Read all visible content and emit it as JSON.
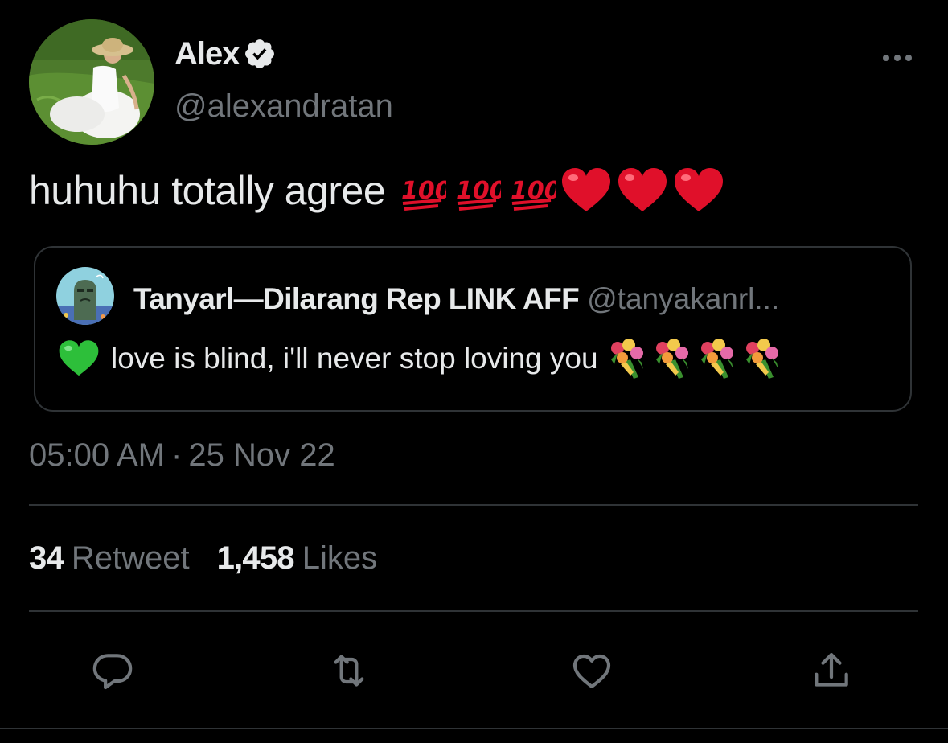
{
  "author": {
    "display_name": "Alex",
    "handle": "@alexandratan",
    "verified_icon": "verified-badge-icon",
    "avatar": "profile-photo-woman-white-dress-on-grass"
  },
  "tweet": {
    "text": "huhuhu totally agree",
    "emojis": [
      "hundred-points",
      "hundred-points",
      "hundred-points",
      "red-heart",
      "red-heart",
      "red-heart"
    ]
  },
  "quote": {
    "display_name": "Tanyarl—Dilarang Rep LINK AFF",
    "handle": "@tanyakanrl...",
    "leading_emoji": "green-heart",
    "text": "love is blind, i'll never stop loving you",
    "trailing_emojis": [
      "bouquet",
      "bouquet",
      "bouquet",
      "bouquet"
    ]
  },
  "meta": {
    "time": "05:00 AM",
    "separator": "·",
    "date": "25 Nov 22"
  },
  "stats": {
    "retweet_count": "34",
    "retweet_label": "Retweet",
    "like_count": "1,458",
    "like_label": "Likes"
  },
  "actions": [
    "reply-icon",
    "retweet-icon",
    "like-icon",
    "share-icon"
  ],
  "colors": {
    "background": "#000000",
    "primary_text": "#e7e9ea",
    "secondary_text": "#71767b",
    "border": "#2f3336",
    "verified_badge": "#e7e9ea",
    "heart_red": "#e0102a",
    "hundred_red": "#e0102a",
    "green_heart": "#2dbf3a"
  }
}
